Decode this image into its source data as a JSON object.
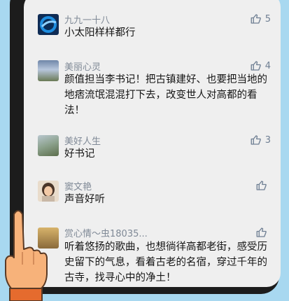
{
  "comments": [
    {
      "user": "九九一十八",
      "text": "小太阳样样都行",
      "likes": "5",
      "avatar_icon": "blue-swirl-avatar"
    },
    {
      "user": "美丽心灵",
      "text": "颜值担当李书记！把古镇建好、也要把当地的地痞流氓混混打下去，改变世人对高都的看法！",
      "likes": "4",
      "avatar_icon": "landscape-avatar"
    },
    {
      "user": "美好人生",
      "text": "好书记",
      "likes": "3",
      "avatar_icon": "rock-landscape-avatar"
    },
    {
      "user": "窦文艳",
      "text": "声音好听",
      "likes": "",
      "avatar_icon": "portrait-avatar"
    },
    {
      "user": "赏心情～虫18035...",
      "text": "听着悠扬的歌曲，也想徜徉高都老街，感受历史留下的气息，看着古老的名宿，穿过千年的古寺，找寻心中的净土！",
      "likes": "",
      "avatar_icon": "scenery-avatar"
    }
  ],
  "colors": {
    "background": "#a8d8f0",
    "screen": "#efefef",
    "like_icon": "#6f7f93"
  }
}
